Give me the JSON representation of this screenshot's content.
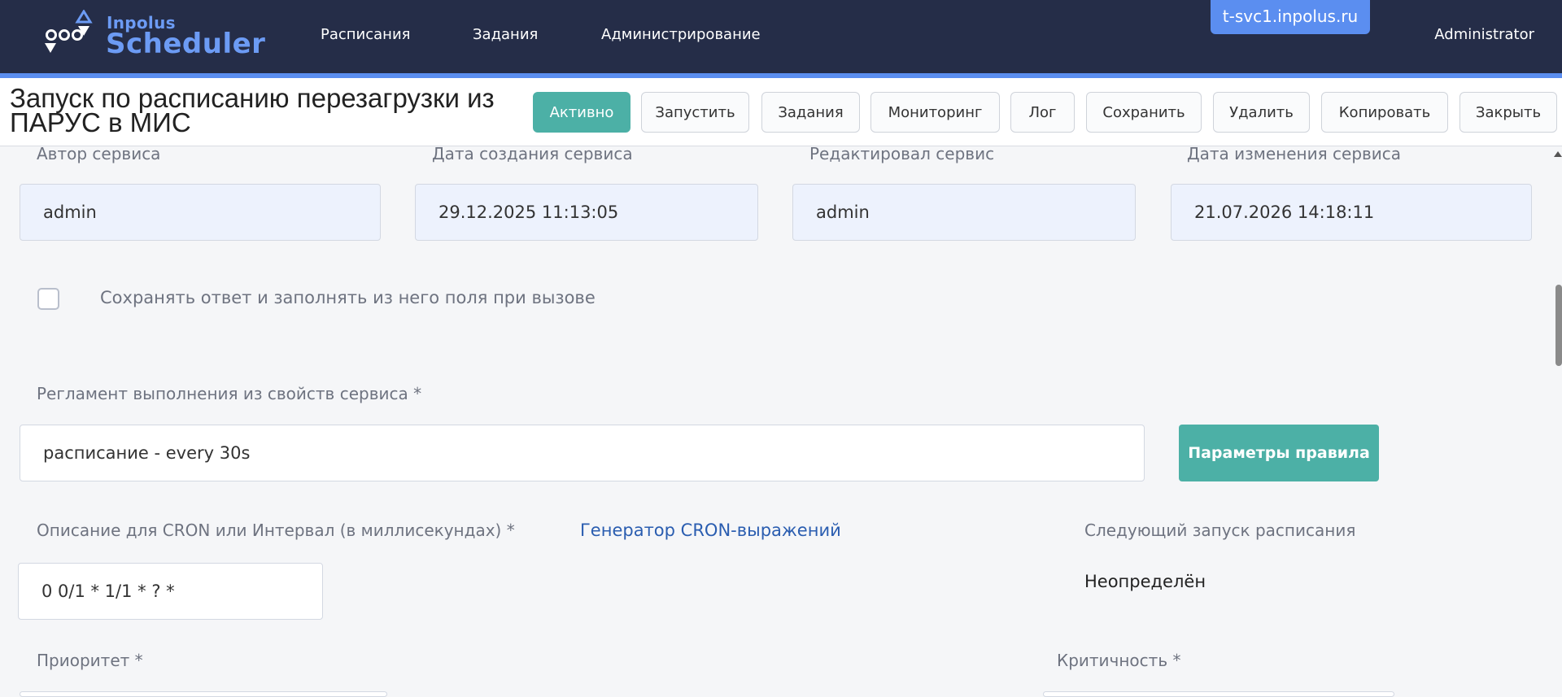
{
  "logo": {
    "sub": "Inpolus",
    "main": "Scheduler"
  },
  "nav": {
    "items": [
      "Расписания",
      "Задания",
      "Администрирование"
    ]
  },
  "host": "t-svc1.inpolus.ru",
  "user": "Administrator",
  "colors": {
    "header": "#252d48",
    "accent": "#5b8ef0",
    "teal": "#4cb0a6",
    "readonly_bg": "#edf2fd",
    "link": "#2a5db0"
  },
  "page": {
    "title": "Запуск по расписанию перезагрузки из ПАРУС в МИС"
  },
  "toolbar": {
    "status_label": "Активно",
    "run_label": "Запустить",
    "tasks_label": "Задания",
    "monitoring_label": "Мониторинг",
    "log_label": "Лог",
    "save_label": "Сохранить",
    "delete_label": "Удалить",
    "copy_label": "Копировать",
    "close_label": "Закрыть"
  },
  "meta": {
    "author_label": "Автор сервиса",
    "author_value": "admin",
    "created_label": "Дата создания сервиса",
    "created_value": "29.12.2025 11:13:05",
    "editor_label": "Редактировал сервис",
    "editor_value": "admin",
    "modified_label": "Дата изменения сервиса",
    "modified_value": "21.07.2026 14:18:11"
  },
  "save_response": {
    "label": "Сохранять ответ и заполнять из него поля при вызове",
    "checked": false
  },
  "schedule": {
    "label": "Регламент выполнения из свойств сервиса *",
    "value": "расписание - every 30s",
    "params_button": "Параметры правила"
  },
  "cron": {
    "label": "Описание для CRON или Интервал (в миллисекундах) *",
    "generator_link": "Генератор CRON-выражений",
    "value": "0 0/1 * 1/1 * ? *"
  },
  "next_run": {
    "label": "Следующий запуск расписания",
    "value": "Неопределён"
  },
  "priority": {
    "label": "Приоритет *"
  },
  "criticality": {
    "label": "Критичность *"
  }
}
